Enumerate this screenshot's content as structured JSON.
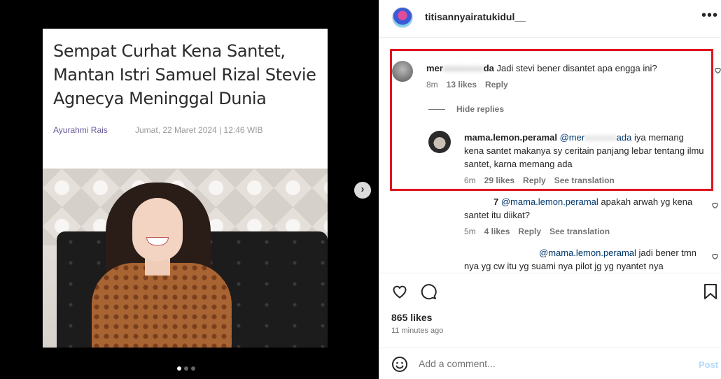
{
  "article": {
    "title": "Sempat Curhat Kena Santet, Mantan Istri Samuel Rizal Stevie Agnecya Meninggal Dunia",
    "author": "Ayurahmi Rais",
    "date": "Jumat, 22 Maret 2024 | 12:46 WIB"
  },
  "carousel": {
    "next_icon": "›"
  },
  "post": {
    "username": "titisannyairatukidul__",
    "more_icon": "•••",
    "likes": "865 likes",
    "time_ago": "11 minutes ago"
  },
  "comments": [
    {
      "user": "mer",
      "user_blur": "xxxxxxxx",
      "user_tail": "da",
      "text": "Jadi stevi bener disantet apa engga ini?",
      "time": "8m",
      "likes": "13 likes",
      "reply": "Reply"
    }
  ],
  "hide_replies": "Hide replies",
  "replies": [
    {
      "user": "mama.lemon.peramal",
      "mention_head": "@mer",
      "mention_blur": "xxxxxxx",
      "mention_tail": "ada",
      "text": "iya memang kena santet makanya sy ceritain panjang lebar tentang ilmu santet, karna memang ada",
      "time": "6m",
      "likes": "29 likes",
      "reply": "Reply",
      "translation": "See translation"
    },
    {
      "user_tail": "7",
      "mention": "@mama.lemon.peramal",
      "text": "apakah arwah yg kena santet itu diikat?",
      "time": "5m",
      "likes": "4 likes",
      "reply": "Reply",
      "translation": "See translation"
    },
    {
      "mention": "@mama.lemon.peramal",
      "text": "jadi bener tmn nya yg cw itu yg suami nya pilot jg yg nyantet nya"
    }
  ],
  "composer": {
    "placeholder": "Add a comment...",
    "post_label": "Post"
  },
  "colors": {
    "highlight": "#e0141e",
    "mention": "#00376b",
    "post_disabled": "#b3dbff"
  }
}
